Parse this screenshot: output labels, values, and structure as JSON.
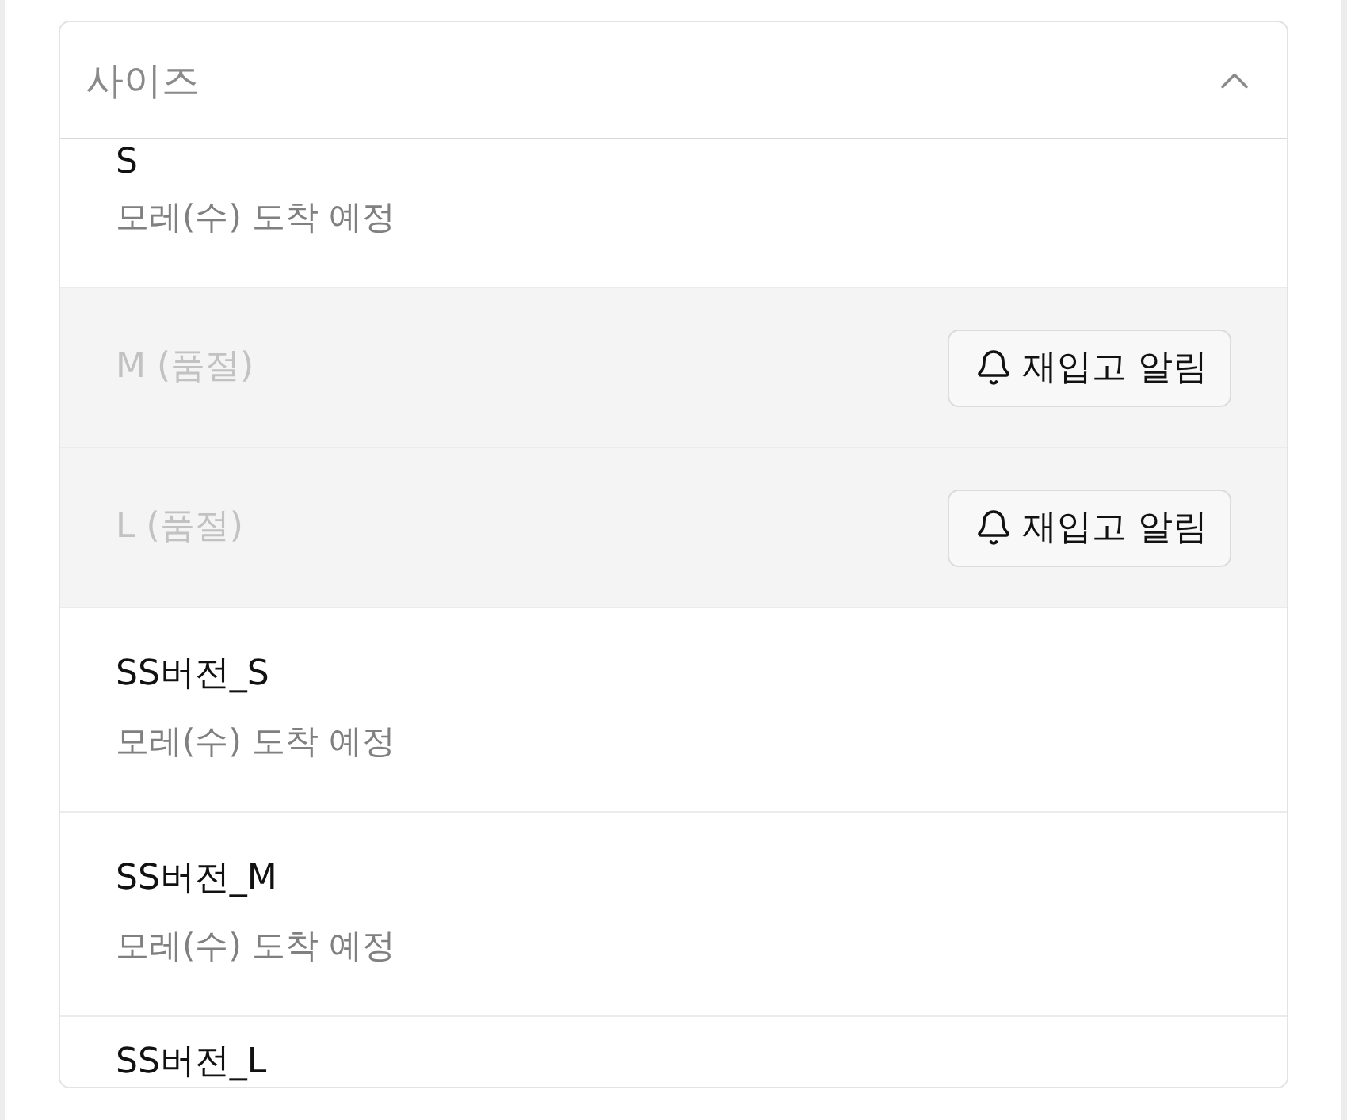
{
  "dropdown": {
    "label": "사이즈",
    "expanded": true
  },
  "options": [
    {
      "name": "S",
      "note": "모레(수) 도착 예정",
      "sold_out": false
    },
    {
      "name": "M (품절)",
      "sold_out": true,
      "button": "재입고 알림"
    },
    {
      "name": "L (품절)",
      "sold_out": true,
      "button": "재입고 알림"
    },
    {
      "name": "SS버전_S",
      "note": "모레(수) 도착 예정",
      "sold_out": false
    },
    {
      "name": "SS버전_M",
      "note": "모레(수) 도착 예정",
      "sold_out": false
    },
    {
      "name": "SS버전_L",
      "sold_out": false
    }
  ]
}
